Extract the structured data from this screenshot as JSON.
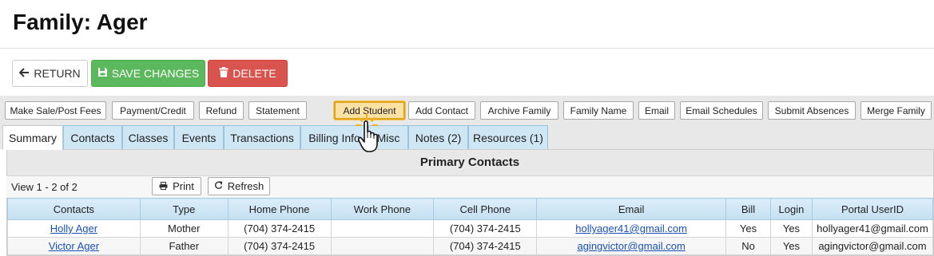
{
  "page": {
    "title": "Family: Ager"
  },
  "actions": {
    "return_label": "RETURN",
    "save_label": "SAVE CHANGES",
    "delete_label": "DELETE"
  },
  "toolbar": {
    "items": [
      "Make Sale/Post Fees",
      "Payment/Credit",
      "Refund",
      "Statement",
      "Add Student",
      "Add Contact",
      "Archive Family",
      "Family Name",
      "Email",
      "Email Schedules",
      "Submit Absences",
      "Merge Family"
    ],
    "highlighted": "Add Student"
  },
  "tabs": {
    "items": [
      "Summary",
      "Contacts",
      "Classes",
      "Events",
      "Transactions",
      "Billing Info",
      "Misc",
      "Notes (2)",
      "Resources (1)"
    ],
    "active": "Summary"
  },
  "panel": {
    "title": "Primary Contacts",
    "view_text": "View 1 - 2 of 2",
    "print_label": "Print",
    "refresh_label": "Refresh"
  },
  "table": {
    "columns": [
      "Contacts",
      "Type",
      "Home Phone",
      "Work Phone",
      "Cell Phone",
      "Email",
      "Bill",
      "Login",
      "Portal UserID"
    ],
    "rows": [
      {
        "contact": "Holly Ager",
        "type": "Mother",
        "home_phone": "(704) 374-2415",
        "work_phone": "",
        "cell_phone": "(704) 374-2415",
        "email": "hollyager41@gmail.com",
        "bill": "Yes",
        "login": "Yes",
        "portal_userid": "hollyager41@gmail.com"
      },
      {
        "contact": "Victor Ager",
        "type": "Father",
        "home_phone": "(704) 374-2415",
        "work_phone": "",
        "cell_phone": "(704) 374-2415",
        "email": "agingvictor@gmail.com",
        "bill": "No",
        "login": "Yes",
        "portal_userid": "agingvictor@gmail.com"
      }
    ]
  },
  "colors": {
    "save": "#5cb85c",
    "delete": "#d9534f",
    "tab": "#cfe6f5",
    "highlight_border": "#e0a41c",
    "link": "#1a50b8"
  },
  "icons": {
    "return": "arrow-left-icon",
    "save": "floppy-disk-icon",
    "delete": "trash-icon",
    "print": "printer-icon",
    "refresh": "refresh-icon",
    "cursor": "hand-pointer-icon"
  }
}
